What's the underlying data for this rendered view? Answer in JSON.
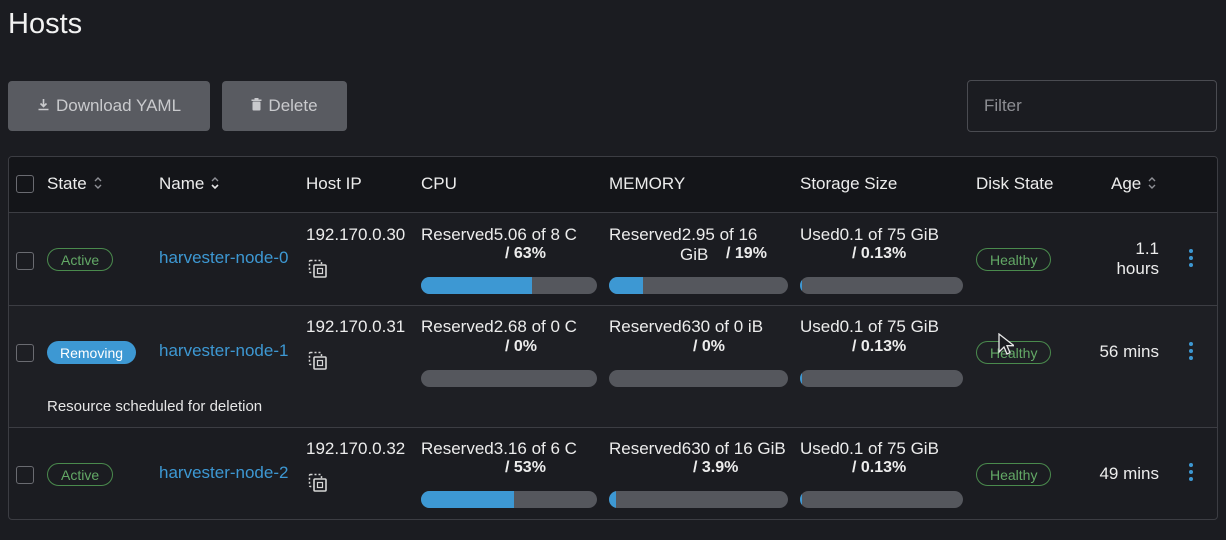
{
  "page": {
    "title": "Hosts"
  },
  "toolbar": {
    "download_label": "Download YAML",
    "download_icon": "download-icon",
    "delete_label": "Delete",
    "delete_icon": "trash-icon",
    "filter_placeholder": "Filter"
  },
  "table": {
    "columns": {
      "state": "State",
      "name": "Name",
      "host_ip": "Host IP",
      "cpu": "CPU",
      "memory": "MEMORY",
      "storage": "Storage Size",
      "disk_state": "Disk State",
      "age": "Age"
    },
    "rows": [
      {
        "state": "Active",
        "name": "harvester-node-0",
        "host_ip": "192.170.0.30",
        "cpu_line1": "Reserved5.06 of 8 C",
        "cpu_pct": "/ 63%",
        "cpu_fill": 0.63,
        "mem_line1": "Reserved2.95 of 16",
        "mem_line2": "GiB",
        "mem_pct": "/ 19%",
        "mem_fill": 0.19,
        "storage_line1": "Used0.1 of 75 GiB",
        "storage_pct": "/ 0.13%",
        "storage_fill": 0.0013,
        "disk_state": "Healthy",
        "age_line1": "1.1",
        "age_line2": "hours"
      },
      {
        "state": "Removing",
        "name": "harvester-node-1",
        "host_ip": "192.170.0.31",
        "cpu_line1": "Reserved2.68 of 0 C",
        "cpu_pct": "/ 0%",
        "cpu_fill": 0,
        "mem_line1": "Reserved630 of 0 iB",
        "mem_pct": "/ 0%",
        "mem_fill": 0,
        "storage_line1": "Used0.1 of 75 GiB",
        "storage_pct": "/ 0.13%",
        "storage_fill": 0.0013,
        "disk_state": "Healthy",
        "age": "56 mins",
        "message": "Resource scheduled for deletion"
      },
      {
        "state": "Active",
        "name": "harvester-node-2",
        "host_ip": "192.170.0.32",
        "cpu_line1": "Reserved3.16 of 6 C",
        "cpu_pct": "/ 53%",
        "cpu_fill": 0.53,
        "mem_line1": "Reserved630 of 16 GiB",
        "mem_pct": "/ 3.9%",
        "mem_fill": 0.039,
        "storage_line1": "Used0.1 of 75 GiB",
        "storage_pct": "/ 0.13%",
        "storage_fill": 0.0013,
        "disk_state": "Healthy",
        "age": "49 mins"
      }
    ]
  },
  "colors": {
    "accent": "#3d98d3",
    "healthy": "#63a866",
    "background": "#1b1c21"
  }
}
